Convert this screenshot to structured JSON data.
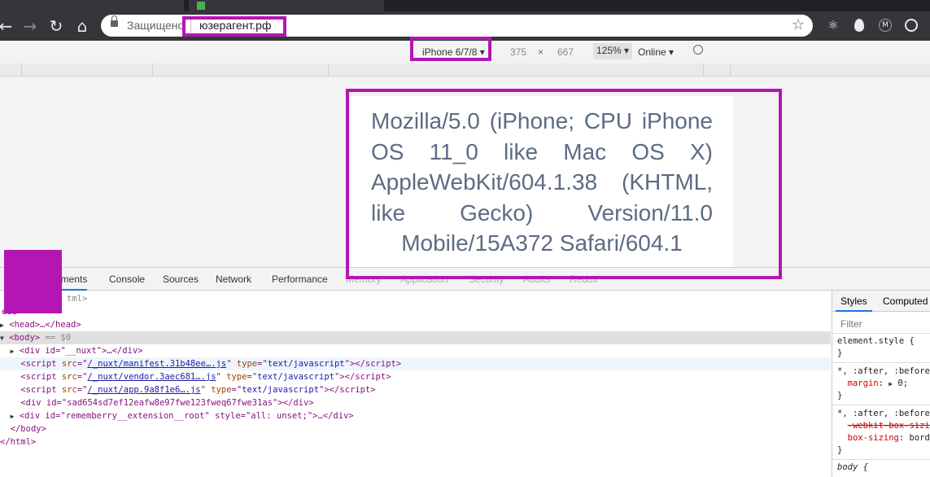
{
  "browser": {
    "secure_label": "Защищено",
    "url": "юзерагент.рф",
    "star_glyph": "☆"
  },
  "device_toolbar": {
    "device": "iPhone 6/7/8",
    "width": "375",
    "times": "×",
    "height": "667",
    "zoom": "125%",
    "network": "Online"
  },
  "page": {
    "user_agent": "Mozilla/5.0 (iPhone; CPU iPhone OS 11_0 like Mac OS X) AppleWebKit/604.1.38 (KHTML, like Gecko) Version/11.0 Mobile/15A372 Safari/604.1"
  },
  "devtools": {
    "tabs": [
      "Elements",
      "Console",
      "Sources",
      "Network",
      "Performance",
      "Memory",
      "Application",
      "Security",
      "Audits",
      "Redux"
    ],
    "elements_partial": "ements",
    "dom": {
      "html_open": "tml>",
      "head_open_partial": "ead>",
      "head": "<head>…</head>",
      "body_open": "<body>",
      "body_marker": " == $0",
      "div_nuxt": "<div id=\"__nuxt\">…</div>",
      "script1_src": "/_nuxt/manifest.31b48ee….js",
      "script2_src": "/_nuxt/vendor.3aec681….js",
      "script3_src": "/_nuxt/app.9a8f1e6….js",
      "script_type": "text/javascript",
      "div_random": "<div id=\"sad654sd7ef12eafw8e97fwe123fweq67fwe31as\"></div>",
      "div_ext": "<div id=\"rememberry__extension__root\" style=\"all: unset;\">…</div>",
      "body_close": "</body>",
      "html_close": "</html>"
    },
    "styles": {
      "tabs": [
        "Styles",
        "Computed"
      ],
      "filter_placeholder": "Filter",
      "rule1_selector": "element.style {",
      "rule1_close": "}",
      "rule2_selector": "*, :after, :before",
      "rule2_prop": "margin",
      "rule2_value": "0;",
      "rule2_close": "}",
      "rule3_selector": "*, :after, :before",
      "rule3_prop_struck": "-webkit-box-sizing",
      "rule3_prop": "box-sizing",
      "rule3_value": "border",
      "rule3_close": "}",
      "rule4_selector": "body {"
    }
  },
  "colors": {
    "highlight": "#b316b3",
    "ua_text": "#5d6b85"
  }
}
